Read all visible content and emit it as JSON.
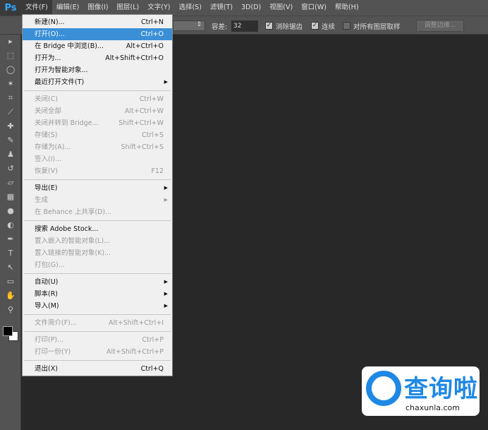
{
  "app_logo": "Ps",
  "menubar": [
    "文件(F)",
    "编辑(E)",
    "图像(I)",
    "图层(L)",
    "文字(Y)",
    "选择(S)",
    "滤镜(T)",
    "3D(D)",
    "视图(V)",
    "窗口(W)",
    "帮助(H)"
  ],
  "options": {
    "tolerance_label": "容差:",
    "tolerance_value": "32",
    "anti_alias": "消除锯齿",
    "contiguous": "连续",
    "sample_all": "对所有图层取样",
    "refine_button": "调整边缘..."
  },
  "file_menu": [
    {
      "label": "新建(N)...",
      "shortcut": "Ctrl+N"
    },
    {
      "label": "打开(O)...",
      "shortcut": "Ctrl+O",
      "highlighted": true
    },
    {
      "label": "在 Bridge 中浏览(B)...",
      "shortcut": "Alt+Ctrl+O"
    },
    {
      "label": "打开为...",
      "shortcut": "Alt+Shift+Ctrl+O"
    },
    {
      "label": "打开为智能对象...",
      "shortcut": ""
    },
    {
      "label": "最近打开文件(T)",
      "shortcut": "",
      "submenu": true
    },
    {
      "sep": true
    },
    {
      "label": "关闭(C)",
      "shortcut": "Ctrl+W",
      "disabled": true
    },
    {
      "label": "关闭全部",
      "shortcut": "Alt+Ctrl+W",
      "disabled": true
    },
    {
      "label": "关闭并转到 Bridge...",
      "shortcut": "Shift+Ctrl+W",
      "disabled": true
    },
    {
      "label": "存储(S)",
      "shortcut": "Ctrl+S",
      "disabled": true
    },
    {
      "label": "存储为(A)...",
      "shortcut": "Shift+Ctrl+S",
      "disabled": true
    },
    {
      "label": "签入(I)...",
      "shortcut": "",
      "disabled": true
    },
    {
      "label": "恢复(V)",
      "shortcut": "F12",
      "disabled": true
    },
    {
      "sep": true
    },
    {
      "label": "导出(E)",
      "shortcut": "",
      "submenu": true
    },
    {
      "label": "生成",
      "shortcut": "",
      "submenu": true,
      "disabled": true
    },
    {
      "label": "在 Behance 上共享(D)...",
      "shortcut": "",
      "disabled": true
    },
    {
      "sep": true
    },
    {
      "label": "搜索 Adobe Stock...",
      "shortcut": ""
    },
    {
      "label": "置入嵌入的智能对象(L)...",
      "shortcut": "",
      "disabled": true
    },
    {
      "label": "置入链接的智能对象(K)...",
      "shortcut": "",
      "disabled": true
    },
    {
      "label": "打包(G)...",
      "shortcut": "",
      "disabled": true
    },
    {
      "sep": true
    },
    {
      "label": "自动(U)",
      "shortcut": "",
      "submenu": true
    },
    {
      "label": "脚本(R)",
      "shortcut": "",
      "submenu": true
    },
    {
      "label": "导入(M)",
      "shortcut": "",
      "submenu": true
    },
    {
      "sep": true
    },
    {
      "label": "文件简介(F)...",
      "shortcut": "Alt+Shift+Ctrl+I",
      "disabled": true
    },
    {
      "sep": true
    },
    {
      "label": "打印(P)...",
      "shortcut": "Ctrl+P",
      "disabled": true
    },
    {
      "label": "打印一份(Y)",
      "shortcut": "Alt+Shift+Ctrl+P",
      "disabled": true
    },
    {
      "sep": true
    },
    {
      "label": "退出(X)",
      "shortcut": "Ctrl+Q"
    }
  ],
  "tools": [
    "move",
    "marquee",
    "lasso",
    "magic-wand",
    "crop",
    "eyedropper",
    "healing",
    "brush",
    "stamp",
    "history-brush",
    "eraser",
    "gradient",
    "blur",
    "dodge",
    "pen",
    "type",
    "path-select",
    "shape",
    "hand",
    "zoom"
  ],
  "watermark": {
    "text": "查询啦",
    "url": "chaxunla.com"
  },
  "colors": {
    "highlight": "#3b8fd6",
    "ps_blue": "#31a8ff"
  }
}
